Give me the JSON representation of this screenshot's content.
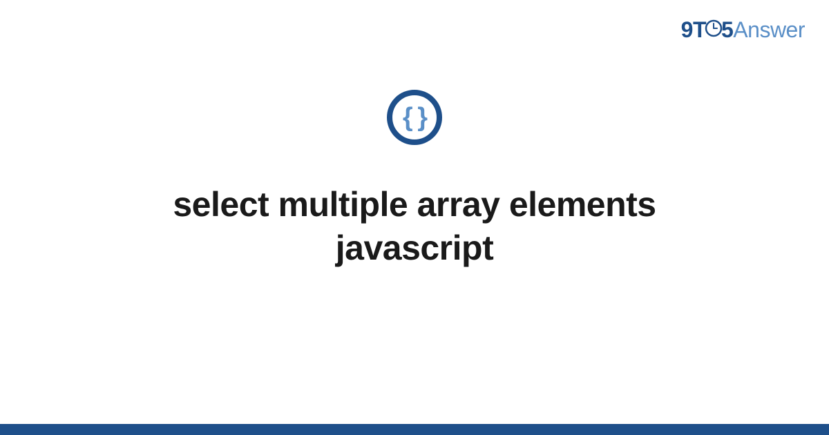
{
  "logo": {
    "part1": "9",
    "part2": "T",
    "part3": "5",
    "part4": "Answer"
  },
  "icon": {
    "braces": "{ }"
  },
  "title": "select multiple array elements javascript",
  "colors": {
    "primary": "#1e4f8a",
    "accent": "#5a8fc7"
  }
}
